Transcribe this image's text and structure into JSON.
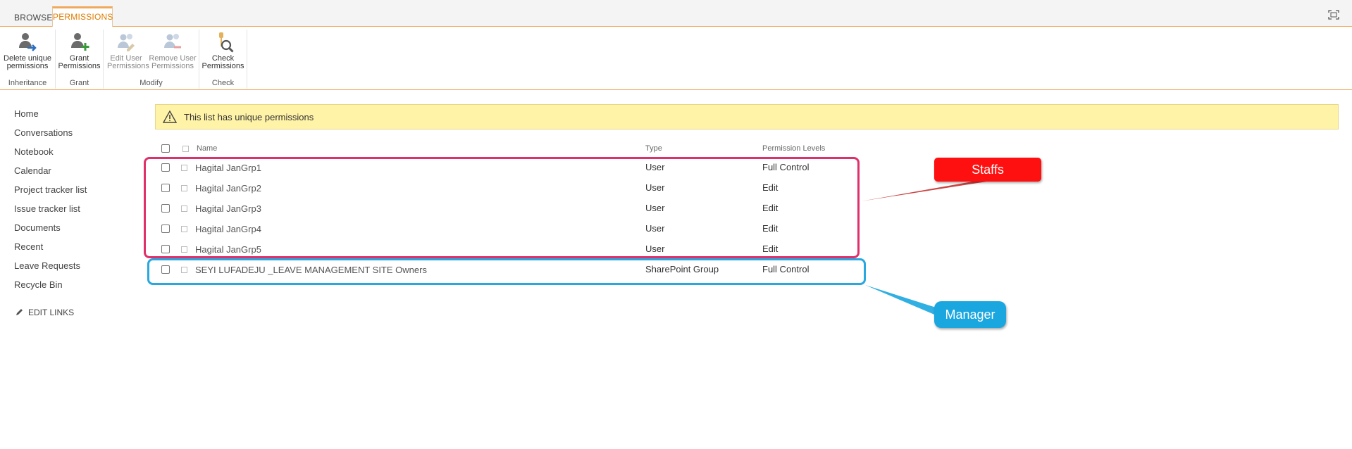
{
  "tabs": {
    "browse": "BROWSE",
    "permissions": "PERMISSIONS"
  },
  "ribbon": {
    "groups": {
      "inheritance": "Inheritance",
      "grant": "Grant",
      "modify": "Modify",
      "check": "Check"
    },
    "buttons": {
      "delete_unique": [
        "Delete unique",
        "permissions"
      ],
      "grant": [
        "Grant",
        "Permissions"
      ],
      "edit_user": [
        "Edit User",
        "Permissions"
      ],
      "remove_user": [
        "Remove User",
        "Permissions"
      ],
      "check": [
        "Check",
        "Permissions"
      ]
    }
  },
  "nav": {
    "items": [
      "Home",
      "Conversations",
      "Notebook",
      "Calendar",
      "Project tracker list",
      "Issue tracker list",
      "Documents",
      "Recent",
      "Leave Requests",
      "Recycle Bin"
    ],
    "edit_links": "EDIT LINKS"
  },
  "banner": {
    "text": "This list has unique permissions"
  },
  "table": {
    "headers": {
      "name": "Name",
      "type": "Type",
      "level": "Permission Levels"
    },
    "rows": [
      {
        "name": "Hagital JanGrp1",
        "type": "User",
        "level": "Full Control"
      },
      {
        "name": "Hagital JanGrp2",
        "type": "User",
        "level": "Edit"
      },
      {
        "name": "Hagital JanGrp3",
        "type": "User",
        "level": "Edit"
      },
      {
        "name": "Hagital JanGrp4",
        "type": "User",
        "level": "Edit"
      },
      {
        "name": "Hagital JanGrp5",
        "type": "User",
        "level": "Edit"
      },
      {
        "name": "SEYI LUFADEJU _LEAVE MANAGEMENT SITE Owners",
        "type": "SharePoint Group",
        "level": "Full Control"
      }
    ]
  },
  "annotations": {
    "staffs": "Staffs",
    "manager": "Manager"
  },
  "colors": {
    "accent": "#f0a85a",
    "staffs_box": "#e0306a",
    "manager_box": "#29a8e0",
    "staffs_callout": "#ff1010",
    "manager_callout": "#1aa6df",
    "banner": "#fff3a8"
  }
}
